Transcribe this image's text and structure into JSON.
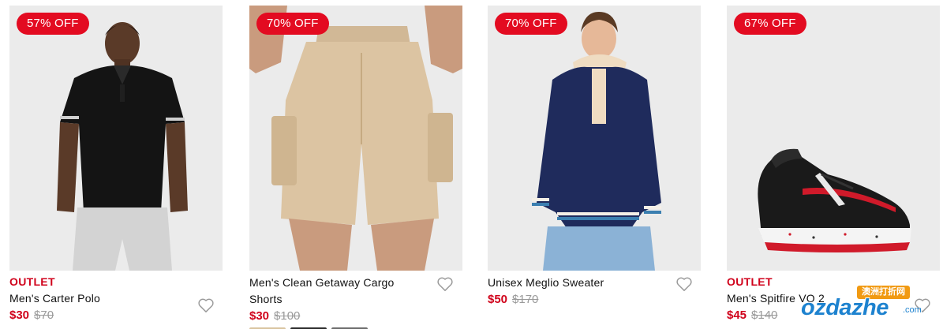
{
  "products": [
    {
      "badge": "57% OFF",
      "tag": "OUTLET",
      "name": "Men's Carter Polo",
      "price": "$30",
      "was_price": "$70",
      "image_icon": "polo-shirt-model-photo",
      "wishlist_icon": "heart-icon"
    },
    {
      "badge": "70% OFF",
      "tag": "",
      "name": "Men's Clean Getaway Cargo Shorts",
      "price": "$30",
      "was_price": "$100",
      "image_icon": "cargo-shorts-model-photo",
      "wishlist_icon": "heart-icon",
      "swatch_colors": [
        "#d9c4a0",
        "#2b2b2b",
        "#6c6c6c"
      ]
    },
    {
      "badge": "70% OFF",
      "tag": "",
      "name": "Unisex Meglio Sweater",
      "price": "$50",
      "was_price": "$170",
      "image_icon": "hooded-sweater-model-photo",
      "wishlist_icon": "heart-icon"
    },
    {
      "badge": "67% OFF",
      "tag": "OUTLET",
      "name": "Men's Spitfire VO 2",
      "price": "$45",
      "was_price": "$140",
      "image_icon": "basketball-sneaker-photo",
      "wishlist_icon": "heart-icon"
    }
  ],
  "watermark": {
    "chinese": "澳洲打折网",
    "brand": "ozdazhe",
    "suffix": ".com"
  },
  "colors": {
    "sale_red": "#d0021b",
    "badge_red": "#e30b21",
    "strike_grey": "#9a9a9a",
    "image_bg": "#ebebeb",
    "watermark_blue": "#1d82cf",
    "watermark_orange": "#f19a12"
  }
}
